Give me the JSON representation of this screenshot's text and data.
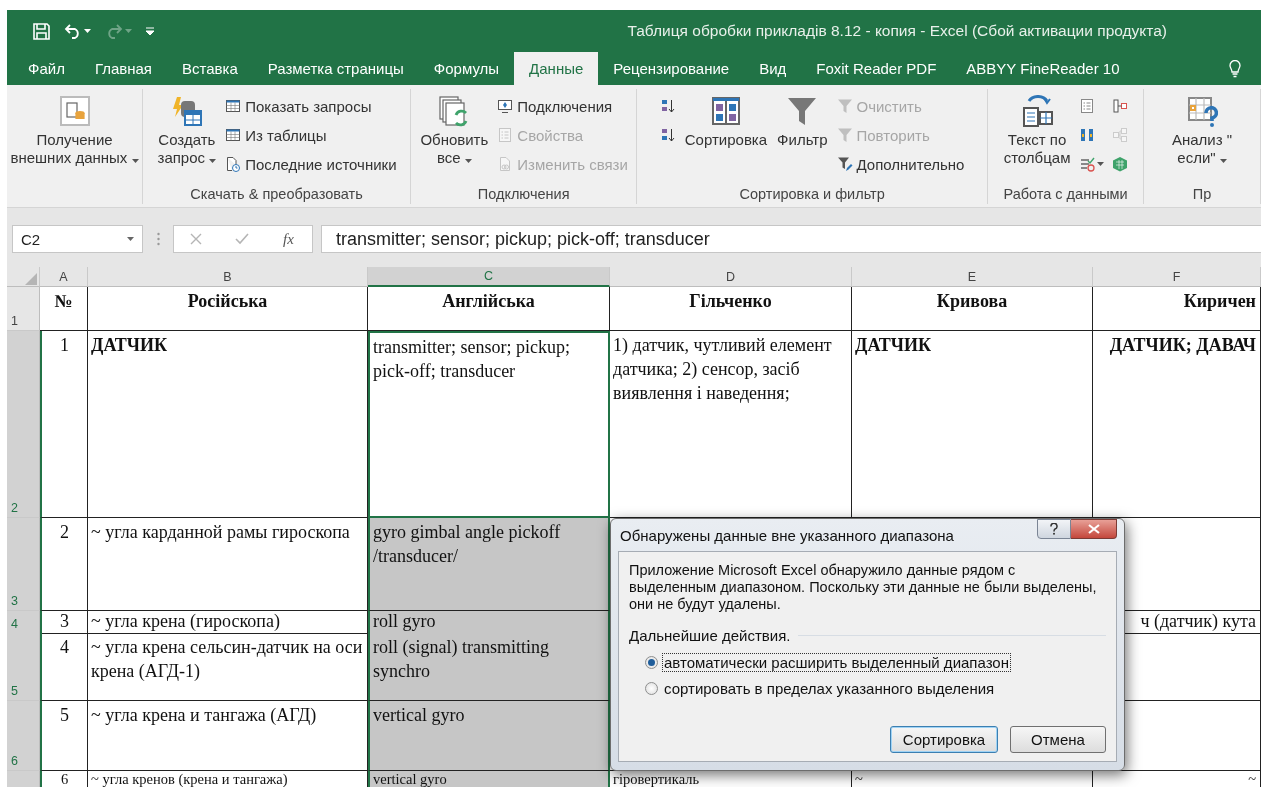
{
  "window": {
    "title": "Таблиця обробки прикладів 8.12 - копия - Excel (Сбой активации продукта)"
  },
  "quick_access": [
    {
      "disabled": false
    },
    {
      "disabled": false
    },
    {
      "disabled": true
    },
    {
      "disabled": false
    }
  ],
  "tabs": [
    {
      "label": "Файл",
      "selected": false
    },
    {
      "label": "Главная",
      "selected": false
    },
    {
      "label": "Вставка",
      "selected": false
    },
    {
      "label": "Разметка страницы",
      "selected": false
    },
    {
      "label": "Формулы",
      "selected": false
    },
    {
      "label": "Данные",
      "selected": true
    },
    {
      "label": "Рецензирование",
      "selected": false
    },
    {
      "label": "Вид",
      "selected": false
    },
    {
      "label": "Foxit Reader PDF",
      "selected": false
    },
    {
      "label": "ABBYY FineReader 10",
      "selected": false
    }
  ],
  "ribbon": {
    "groups": [
      {
        "columns": [
          [
            {
              "kind": "large",
              "label": "Получение\nвнешних данных",
              "dropdown": true,
              "disabled": false
            }
          ]
        ]
      },
      {
        "label": "Скачать & преобразовать",
        "columns": [
          [
            {
              "kind": "large",
              "label": "Создать\nзапрос",
              "dropdown": true,
              "disabled": false
            }
          ],
          [
            {
              "kind": "small",
              "label": "Показать запросы",
              "dropdown": false,
              "disabled": false
            },
            {
              "kind": "small",
              "label": "Из таблицы",
              "dropdown": false,
              "disabled": false
            },
            {
              "kind": "small",
              "label": "Последние источники",
              "dropdown": false,
              "disabled": false
            }
          ]
        ]
      },
      {
        "label": "Подключения",
        "columns": [
          [
            {
              "kind": "large",
              "label": "Обновить\nвсе",
              "dropdown": true,
              "disabled": false
            }
          ],
          [
            {
              "kind": "small",
              "label": "Подключения",
              "dropdown": false,
              "disabled": false
            },
            {
              "kind": "small",
              "label": "Свойства",
              "dropdown": false,
              "disabled": true
            },
            {
              "kind": "small",
              "label": "Изменить связи",
              "dropdown": false,
              "disabled": true
            }
          ]
        ]
      },
      {
        "label": "Сортировка и фильтр",
        "columns": [
          [
            {
              "kind": "icon",
              "dropdown": false,
              "disabled": false
            },
            {
              "kind": "icon",
              "dropdown": false,
              "disabled": false
            }
          ],
          [
            {
              "kind": "large",
              "label": "Сортировка",
              "dropdown": false,
              "disabled": false
            }
          ],
          [
            {
              "kind": "large",
              "label": "Фильтр",
              "dropdown": false,
              "disabled": false
            }
          ],
          [
            {
              "kind": "small",
              "label": "Очистить",
              "dropdown": false,
              "disabled": true
            },
            {
              "kind": "small",
              "label": "Повторить",
              "dropdown": false,
              "disabled": true
            },
            {
              "kind": "small",
              "label": "Дополнительно",
              "dropdown": false,
              "disabled": false
            }
          ]
        ]
      },
      {
        "label": "Работа с данными",
        "columns": [
          [
            {
              "kind": "large",
              "label": "Текст по\nстолбцам",
              "dropdown": false,
              "disabled": false
            }
          ],
          [
            {
              "kind": "icon",
              "dropdown": false,
              "disabled": false
            },
            {
              "kind": "icon",
              "dropdown": false,
              "disabled": false
            },
            {
              "kind": "icon",
              "dropdown": true,
              "disabled": false
            }
          ],
          [
            {
              "kind": "icon",
              "dropdown": false,
              "disabled": false
            },
            {
              "kind": "icon",
              "dropdown": false,
              "disabled": true
            },
            {
              "kind": "icon",
              "dropdown": false,
              "disabled": false
            }
          ]
        ]
      },
      {
        "label": "Пр",
        "columns": [
          [
            {
              "kind": "large",
              "label": "Анализ \"\nесли\"",
              "dropdown": true,
              "disabled": false
            }
          ]
        ]
      }
    ]
  },
  "formula_bar": {
    "name_box": "C2",
    "function_label": "fx",
    "value": "transmitter; sensor; pickup; pick-off; transducer"
  },
  "sheet": {
    "columns": [
      {
        "letter": "A",
        "selected": false
      },
      {
        "letter": "B",
        "selected": false
      },
      {
        "letter": "C",
        "selected": true
      },
      {
        "letter": "D",
        "selected": false
      },
      {
        "letter": "E",
        "selected": false
      },
      {
        "letter": "F",
        "selected": false
      }
    ],
    "rows": [
      {
        "number": "1",
        "selected": false,
        "cells": [
          {
            "text": "№",
            "bold": true,
            "shaded": false
          },
          {
            "text": "Російська",
            "bold": true,
            "shaded": false
          },
          {
            "text": "Англійська",
            "bold": true,
            "shaded": false
          },
          {
            "text": "Гільченко",
            "bold": true,
            "shaded": false
          },
          {
            "text": "Кривова",
            "bold": true,
            "shaded": false
          },
          {
            "text": "Киричен",
            "bold": true,
            "shaded": false
          }
        ]
      },
      {
        "number": "2",
        "selected": true,
        "cells": [
          {
            "text": "1",
            "bold": false,
            "shaded": false
          },
          {
            "text": "ДАТЧИК",
            "bold": true,
            "shaded": false
          },
          {
            "text": "transmitter; sensor; pickup; pick-off; transducer",
            "bold": false,
            "shaded": false
          },
          {
            "text": "1) датчик, чутливий елемент датчика; 2) сенсор, засіб виявлення і наведення;",
            "bold": false,
            "shaded": false
          },
          {
            "text": "ДАТЧИК",
            "bold": true,
            "shaded": false
          },
          {
            "text": "ДАТЧИК; ДАВАЧ",
            "bold": true,
            "shaded": false
          }
        ]
      },
      {
        "number": "3",
        "selected": true,
        "cells": [
          {
            "text": "2",
            "bold": false,
            "shaded": false
          },
          {
            "text": "~ угла карданной рамы гироскопа",
            "bold": false,
            "shaded": false
          },
          {
            "text": "gyro gimbal angle pickoff /transducer/",
            "bold": false,
            "shaded": true
          },
          null,
          null,
          null
        ]
      },
      {
        "number": "4",
        "selected": true,
        "cells": [
          {
            "text": "3",
            "bold": false,
            "shaded": false
          },
          {
            "text": "~ угла крена (гироскопа)",
            "bold": false,
            "shaded": false
          },
          {
            "text": "roll gyro",
            "bold": false,
            "shaded": true
          },
          null,
          null,
          {
            "text": "ч (датчик) кута",
            "bold": false,
            "shaded": false
          }
        ]
      },
      {
        "number": "5",
        "selected": true,
        "cells": [
          {
            "text": "4",
            "bold": false,
            "shaded": false
          },
          {
            "text": "~ угла крена сельсин-датчик на оси крена (АГД-1)",
            "bold": false,
            "shaded": false
          },
          {
            "text": "roll (signal) transmitting synchro",
            "bold": false,
            "shaded": true
          },
          null,
          null,
          null
        ]
      },
      {
        "number": "6",
        "selected": true,
        "cells": [
          {
            "text": "5",
            "bold": false,
            "shaded": false
          },
          {
            "text": "~ угла крена и тангажа (АГД)",
            "bold": false,
            "shaded": false
          },
          {
            "text": "vertical gyro",
            "bold": false,
            "shaded": true
          },
          null,
          null,
          null
        ]
      },
      {
        "selected": true,
        "cells": [
          {
            "text": "6",
            "bold": false,
            "shaded": false
          },
          {
            "text": "~ угла кренов (крена и тангажа)",
            "bold": false,
            "shaded": false
          },
          {
            "text": "vertical gyro",
            "bold": false,
            "shaded": true
          },
          {
            "text": "гіровертикаль",
            "bold": false,
            "shaded": false
          },
          {
            "text": "~",
            "bold": false,
            "shaded": false
          },
          {
            "text": "~",
            "bold": false,
            "shaded": false
          }
        ]
      }
    ]
  },
  "dialog": {
    "title": "Обнаружены данные вне указанного диапазона",
    "message": "Приложение Microsoft Excel обнаружило данные рядом с выделенным диапазоном. Поскольку эти данные не были выделены, они не будут удалены.",
    "section": "Дальнейшие действия.",
    "options": [
      {
        "label": "автоматически расширить выделенный диапазон",
        "selected": true,
        "focused": true
      },
      {
        "label": "сортировать в пределах указанного выделения",
        "selected": false,
        "focused": false
      }
    ],
    "buttons": [
      {
        "label": "Сортировка",
        "default": true
      },
      {
        "label": "Отмена",
        "default": false
      }
    ]
  }
}
